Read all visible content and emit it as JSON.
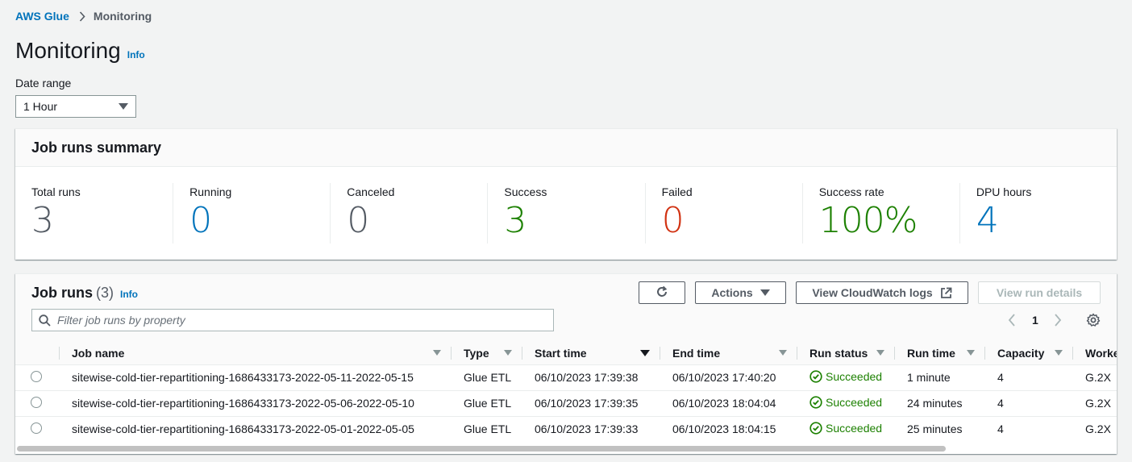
{
  "breadcrumb": {
    "root": "AWS Glue",
    "current": "Monitoring"
  },
  "page": {
    "title": "Monitoring",
    "info": "Info"
  },
  "date_range": {
    "label": "Date range",
    "value": "1 Hour"
  },
  "summary": {
    "title": "Job runs summary",
    "metrics": [
      {
        "label": "Total runs",
        "value": "3",
        "color": "#545b64"
      },
      {
        "label": "Running",
        "value": "0",
        "color": "#0073bb"
      },
      {
        "label": "Canceled",
        "value": "0",
        "color": "#545b64"
      },
      {
        "label": "Success",
        "value": "3",
        "color": "#1d8102"
      },
      {
        "label": "Failed",
        "value": "0",
        "color": "#d13212"
      },
      {
        "label": "Success rate",
        "value": "100%",
        "color": "#1d8102"
      },
      {
        "label": "DPU hours",
        "value": "4",
        "color": "#0073bb"
      }
    ]
  },
  "job_runs": {
    "title": "Job runs",
    "count": "(3)",
    "info": "Info",
    "actions_label": "Actions",
    "cloudwatch_label": "View CloudWatch logs",
    "details_label": "View run details",
    "filter_placeholder": "Filter job runs by property",
    "page": "1",
    "columns": [
      "Job name",
      "Type",
      "Start time",
      "End time",
      "Run status",
      "Run time",
      "Capacity",
      "Worker"
    ],
    "rows": [
      {
        "name": "sitewise-cold-tier-repartitioning-1686433173-2022-05-11-2022-05-15",
        "type": "Glue ETL",
        "start": "06/10/2023 17:39:38",
        "end": "06/10/2023 17:40:20",
        "status": "Succeeded",
        "runtime": "1 minute",
        "capacity": "4",
        "worker": "G.2X"
      },
      {
        "name": "sitewise-cold-tier-repartitioning-1686433173-2022-05-06-2022-05-10",
        "type": "Glue ETL",
        "start": "06/10/2023 17:39:35",
        "end": "06/10/2023 18:04:04",
        "status": "Succeeded",
        "runtime": "24 minutes",
        "capacity": "4",
        "worker": "G.2X"
      },
      {
        "name": "sitewise-cold-tier-repartitioning-1686433173-2022-05-01-2022-05-05",
        "type": "Glue ETL",
        "start": "06/10/2023 17:39:33",
        "end": "06/10/2023 18:04:15",
        "status": "Succeeded",
        "runtime": "25 minutes",
        "capacity": "4",
        "worker": "G.2X"
      }
    ]
  }
}
